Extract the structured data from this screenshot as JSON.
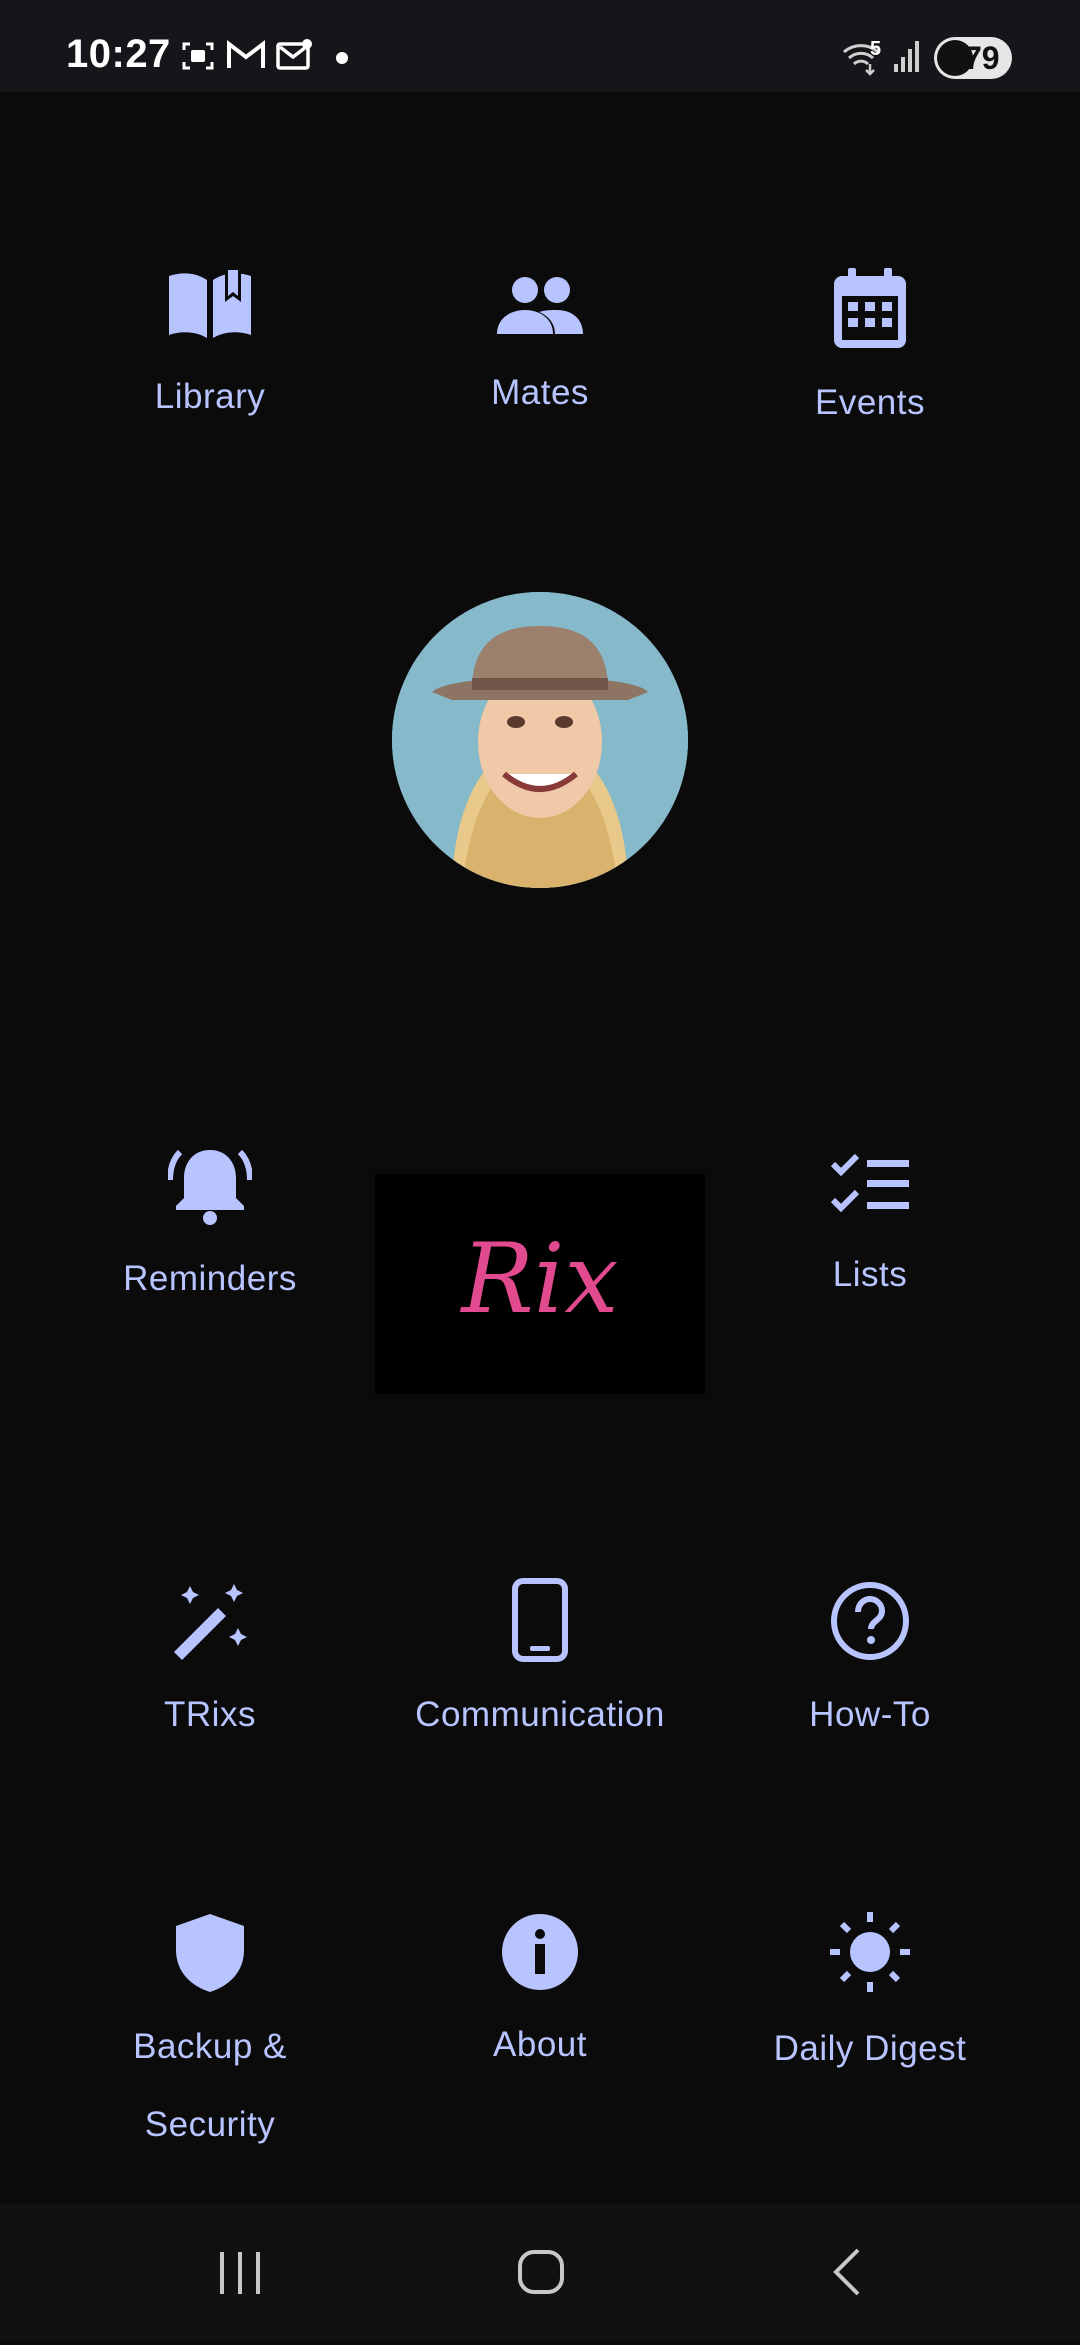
{
  "status_bar": {
    "time": "10:27",
    "network_label": "5",
    "battery": "79"
  },
  "menu": {
    "items": [
      {
        "label": "Library",
        "icon": "book-open-icon"
      },
      {
        "label": "Mates",
        "icon": "people-icon"
      },
      {
        "label": "Events",
        "icon": "calendar-icon"
      },
      {
        "label": "Reminders",
        "icon": "bell-icon"
      },
      {
        "label": "Lists",
        "icon": "checklist-icon"
      },
      {
        "label": "TRixs",
        "icon": "magic-wand-icon"
      },
      {
        "label": "Communication",
        "icon": "phone-icon"
      },
      {
        "label": "How-To",
        "icon": "help-circle-icon"
      },
      {
        "label": "Backup &\nSecurity",
        "icon": "shield-icon"
      },
      {
        "label": "About",
        "icon": "info-icon"
      },
      {
        "label": "Daily Digest",
        "icon": "sun-icon"
      }
    ]
  },
  "brand": {
    "logo_text": "Rix"
  },
  "colors": {
    "accent": "#b8c4ff",
    "background": "#0b0b0c"
  }
}
